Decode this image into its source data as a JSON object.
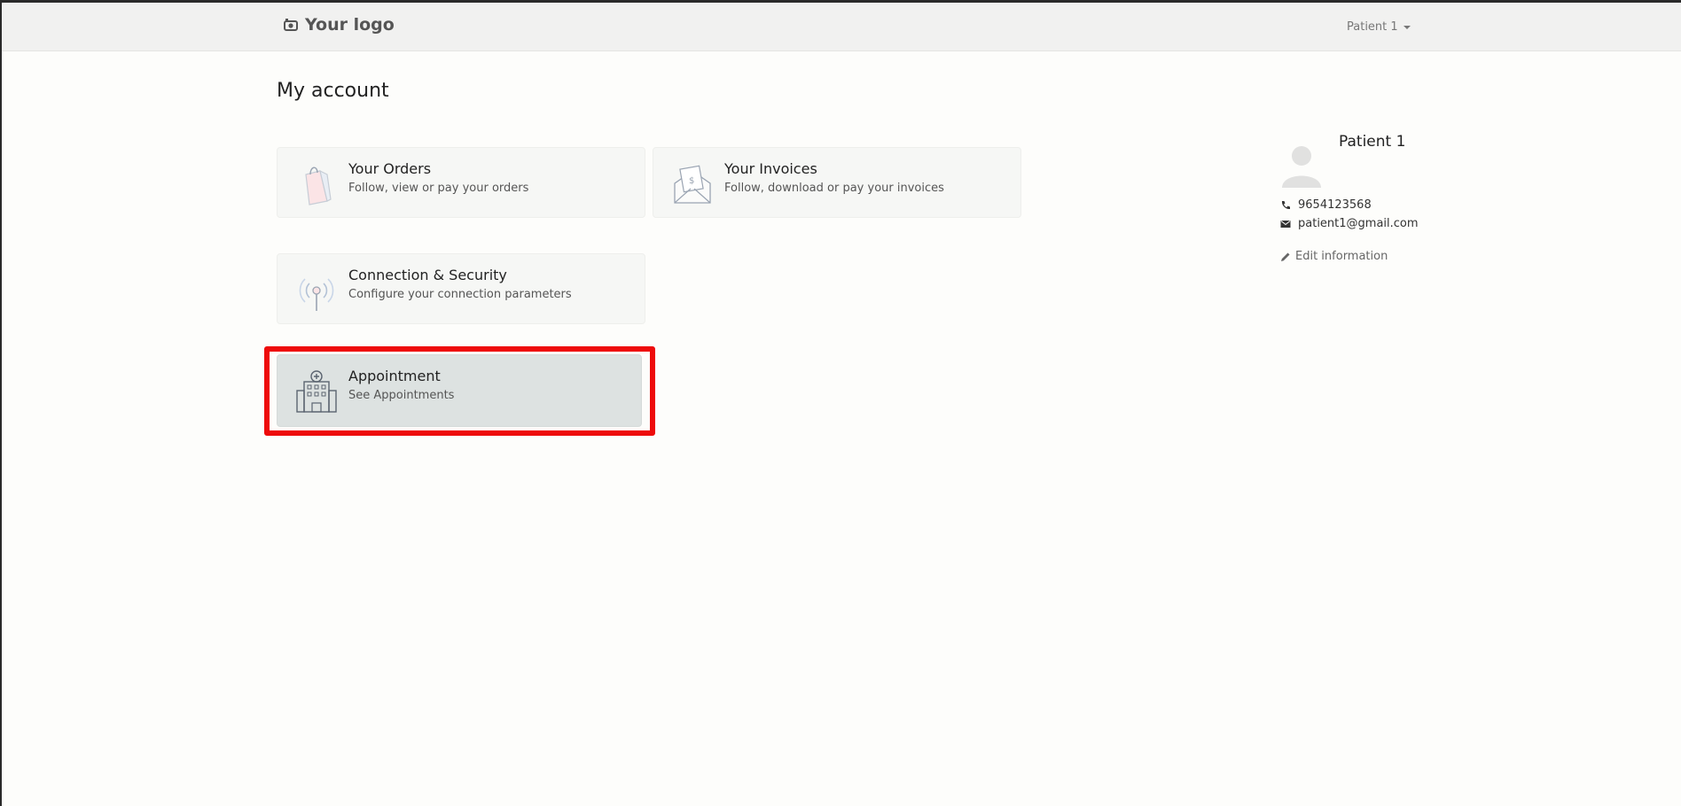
{
  "header": {
    "logo_text": "Your logo",
    "user_menu_label": "Patient 1"
  },
  "page": {
    "title": "My account"
  },
  "cards": [
    {
      "title": "Your Orders",
      "description": "Follow, view or pay your orders",
      "icon": "shopping-bag-icon"
    },
    {
      "title": "Your Invoices",
      "description": "Follow, download or pay your invoices",
      "icon": "invoice-envelope-icon"
    },
    {
      "title": "Connection & Security",
      "description": "Configure your connection parameters",
      "icon": "antenna-icon"
    },
    {
      "title": "Appointment",
      "description": "See Appointments",
      "icon": "hospital-building-icon"
    }
  ],
  "profile": {
    "name": "Patient 1",
    "phone": "9654123568",
    "email": "patient1@gmail.com",
    "edit_label": "Edit information"
  },
  "colors": {
    "highlight": "#ee0b0b",
    "navbar_bg": "#f1f1f0",
    "card_bg": "#f6f7f5",
    "selected_card_bg": "#dde2e1"
  }
}
